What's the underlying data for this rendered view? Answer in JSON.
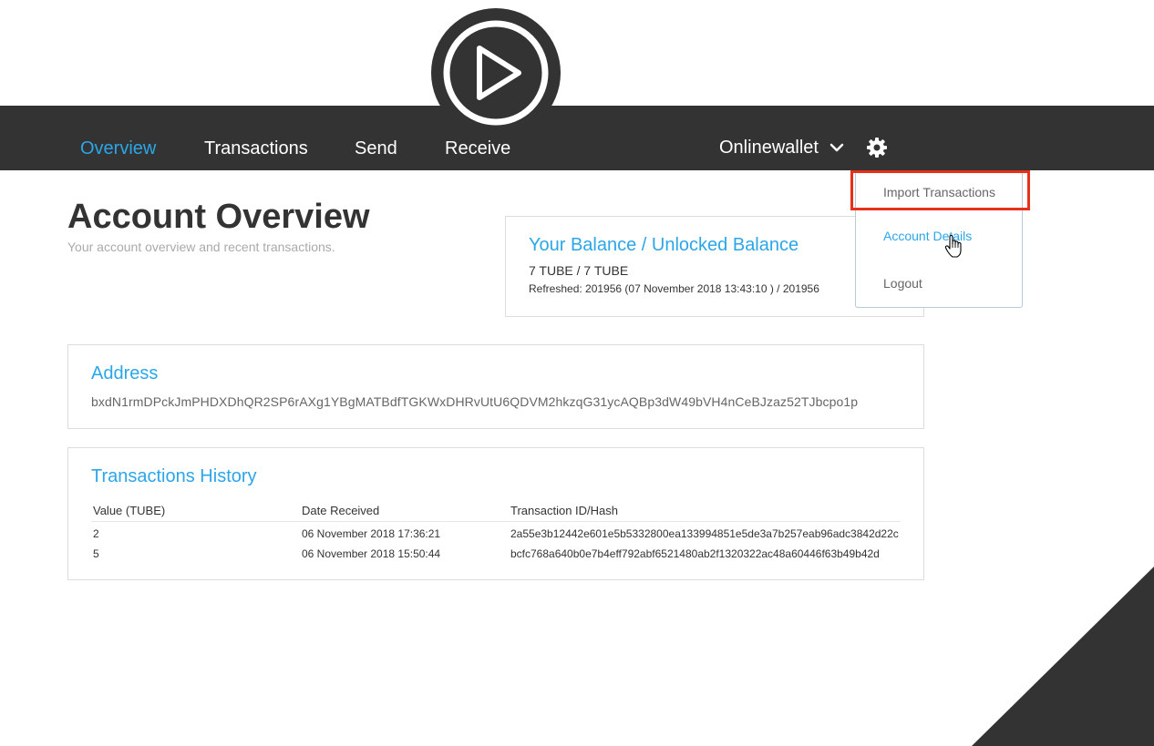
{
  "nav": {
    "items": [
      {
        "label": "Overview",
        "active": true
      },
      {
        "label": "Transactions"
      },
      {
        "label": "Send"
      },
      {
        "label": "Receive"
      }
    ],
    "wallet_name": "Onlinewallet",
    "accent_color": "#2ba6e8",
    "bar_color": "#333333"
  },
  "dropdown": {
    "items": [
      {
        "label": "Import Transactions"
      },
      {
        "label": "Account Details"
      },
      {
        "label": "Logout"
      }
    ],
    "highlight_color": "#e8311b"
  },
  "page": {
    "title": "Account Overview",
    "subtitle": "Your account overview and recent transactions."
  },
  "balance": {
    "title": "Your Balance / Unlocked Balance",
    "value": "7 TUBE / 7 TUBE",
    "refreshed": "Refreshed: 201956 (07 November 2018 13:43:10 ) / 201956"
  },
  "address": {
    "title": "Address",
    "value": "bxdN1rmDPckJmPHDXDhQR2SP6rAXg1YBgMATBdfTGKWxDHRvUtU6QDVM2hkzqG31ycAQBp3dW49bVH4nCeBJzaz52TJbcpo1p"
  },
  "history": {
    "title": "Transactions History",
    "columns": [
      "Value (TUBE)",
      "Date Received",
      "Transaction ID/Hash"
    ],
    "rows": [
      {
        "value": "2",
        "date": "06 November 2018 17:36:21",
        "hash": "2a55e3b12442e601e5b5332800ea133994851e5de3a7b257eab96adc3842d22c"
      },
      {
        "value": "5",
        "date": "06 November 2018 15:50:44",
        "hash": "bcfc768a640b0e7b4eff792abf6521480ab2f1320322ac48a60446f63b49b42d"
      }
    ]
  }
}
